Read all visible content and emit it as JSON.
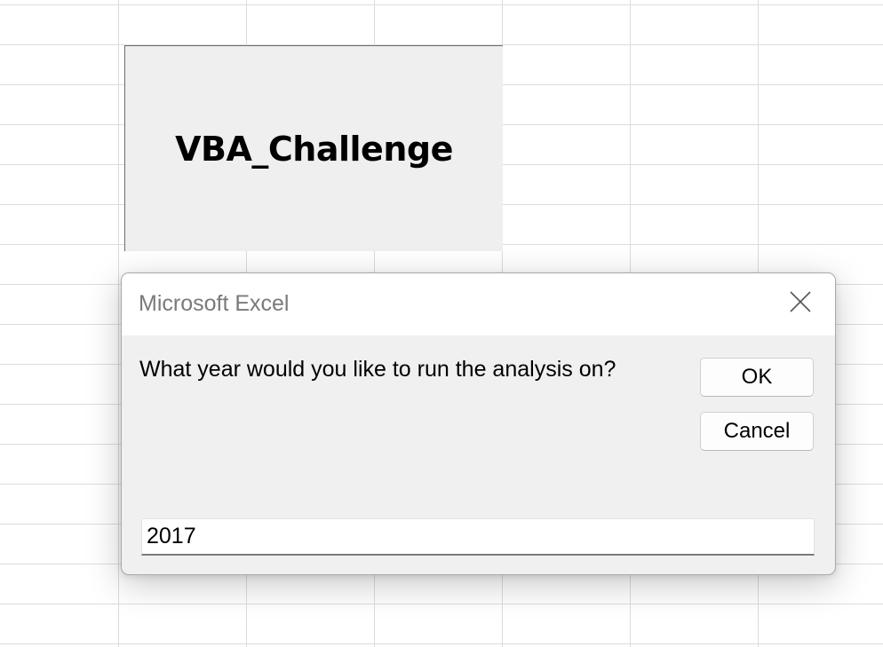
{
  "worksheet": {
    "macro_button_label": "VBA_Challenge"
  },
  "dialog": {
    "title": "Microsoft Excel",
    "prompt": "What year would you like to run the analysis on?",
    "ok_label": "OK",
    "cancel_label": "Cancel",
    "input_value": "2017",
    "close_icon": "close-icon"
  }
}
